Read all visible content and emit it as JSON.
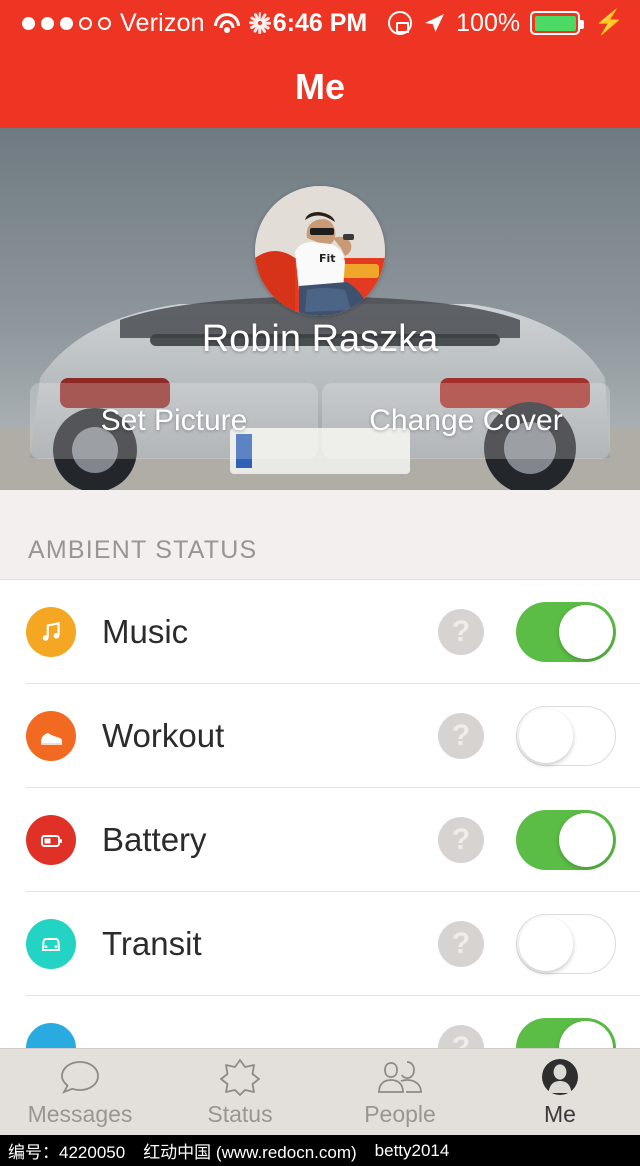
{
  "statusbar": {
    "signal_filled": 3,
    "signal_empty": 2,
    "carrier": "Verizon",
    "wifi_icon": "wifi-icon",
    "activity_icon": "activity-spinner-icon",
    "time": "6:46 PM",
    "rotation_lock_icon": "rotation-lock-icon",
    "location_icon": "location-arrow-icon",
    "battery_percent": "100%",
    "battery_charging_icon": "lightning-bolt-icon",
    "battery_color": "#4CD964"
  },
  "navbar": {
    "title": "Me",
    "background": "#EE3523"
  },
  "profile": {
    "name": "Robin Raszka",
    "avatar_name": "profile-avatar",
    "cover_name": "cover-photo",
    "buttons": [
      {
        "label": "Set Picture",
        "name": "set-picture-button"
      },
      {
        "label": "Change Cover",
        "name": "change-cover-button"
      }
    ]
  },
  "section": {
    "header": "AMBIENT STATUS"
  },
  "rows": [
    {
      "label": "Music",
      "icon": "music-note-icon",
      "icon_color": "#F5A623",
      "toggle": "on",
      "help": "?"
    },
    {
      "label": "Workout",
      "icon": "sneaker-icon",
      "icon_color": "#F26A21",
      "toggle": "off",
      "help": "?"
    },
    {
      "label": "Battery",
      "icon": "battery-icon",
      "icon_color": "#E03127",
      "toggle": "on",
      "help": "?"
    },
    {
      "label": "Transit",
      "icon": "car-icon",
      "icon_color": "#23D3C4",
      "toggle": "off",
      "help": "?"
    },
    {
      "label": "",
      "icon": "partial-icon",
      "icon_color": "#29ABE2",
      "toggle": "on",
      "help": "?"
    }
  ],
  "tabs": [
    {
      "label": "Messages",
      "icon": "speech-bubble-icon",
      "active": false
    },
    {
      "label": "Status",
      "icon": "starburst-icon",
      "active": false
    },
    {
      "label": "People",
      "icon": "people-icon",
      "active": false
    },
    {
      "label": "Me",
      "icon": "person-avatar-icon",
      "active": true
    }
  ],
  "footer": {
    "id_text": "编号：4220050",
    "site_text": "红动中国 (www.redocn.com)",
    "user_text": "betty2014"
  },
  "colors": {
    "brand_red": "#EE3523",
    "toggle_on_green": "#5BBD45",
    "section_bg": "#F3EFEE",
    "tabbar_bg": "#E3E0DC"
  }
}
